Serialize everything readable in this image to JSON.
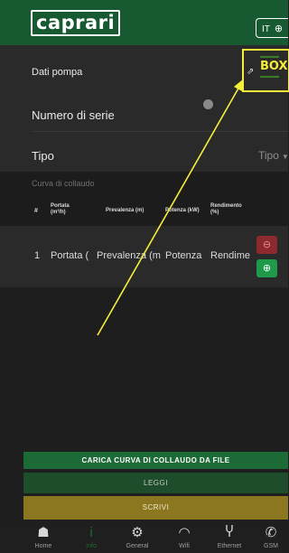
{
  "header": {
    "logo_text": "caprari",
    "language": "IT"
  },
  "pump": {
    "section_label": "Dati pompa",
    "serial_label": "Numero di serie",
    "type_label": "Tipo",
    "type_select_value": "Tipo",
    "box_label": "BOX"
  },
  "curve": {
    "title": "Curva di collaudo",
    "columns": [
      {
        "line1": "#",
        "line2": ""
      },
      {
        "line1": "Portata",
        "line2": "(m³/h)"
      },
      {
        "line1": "Prevalenza (m)",
        "line2": ""
      },
      {
        "line1": "Potenza (kW)",
        "line2": ""
      },
      {
        "line1": "Rendimento",
        "line2": "(%)"
      }
    ],
    "rows": [
      {
        "index": "1",
        "portata": "Portata (",
        "prevalenza": "Prevalenza (m",
        "potenza": "Potenza",
        "rendimento": "Rendime"
      }
    ]
  },
  "buttons": {
    "carica": "CARICA CURVA DI COLLAUDO DA FILE",
    "leggi": "LEGGI",
    "scrivi": "SCRIVI"
  },
  "nav": [
    {
      "label": "Home",
      "icon": "home-icon",
      "glyph": "☗"
    },
    {
      "label": "Info",
      "icon": "info-icon",
      "glyph": "i"
    },
    {
      "label": "General",
      "icon": "gear-icon",
      "glyph": "⚙"
    },
    {
      "label": "Wifi",
      "icon": "wifi-icon",
      "glyph": "◠"
    },
    {
      "label": "Ethernet",
      "icon": "ethernet-icon",
      "glyph": "Ⴤ"
    },
    {
      "label": "GSM",
      "icon": "phone-icon",
      "glyph": "✆"
    }
  ],
  "colors": {
    "brand_green": "#175930",
    "highlight_yellow": "#f5ef3a",
    "minus_red": "#8c2a2f",
    "plus_green": "#1e9a4a",
    "scrivi_gold": "#8a7720"
  }
}
